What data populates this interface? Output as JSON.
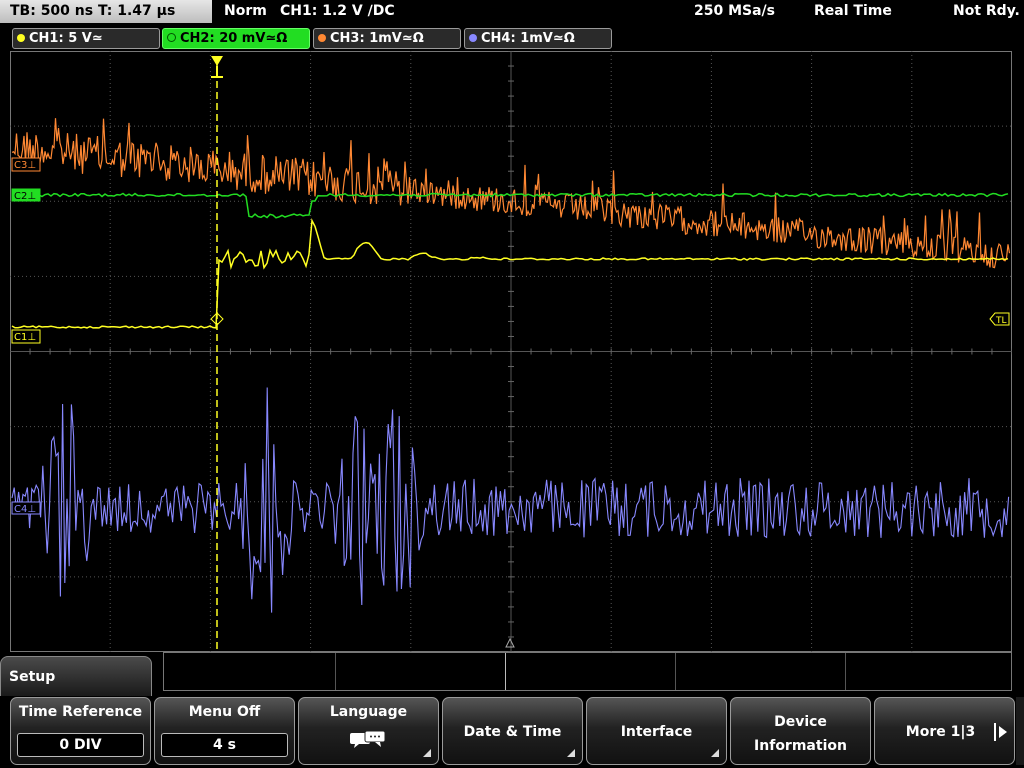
{
  "status": {
    "timebase": "TB: 500 ns   T: 1.47 µs",
    "trigger_mode": "Norm",
    "trigger": "CH1: 1.2 V ∕DC",
    "sample_rate": "250 MSa/s",
    "acq_mode": "Real Time",
    "state": "Not Rdy."
  },
  "channels": [
    {
      "label": "CH1: 5 V≃",
      "color": "#ffff22"
    },
    {
      "label": "CH2: 20 mV≃Ω",
      "color": "#22dd22"
    },
    {
      "label": "CH3: 1mV≃Ω",
      "color": "#ff8833"
    },
    {
      "label": "CH4: 1mV≃Ω",
      "color": "#8888ff"
    }
  ],
  "markers": {
    "c3": "C3⊥",
    "c2": "C2⊥",
    "c1": "C1⊥",
    "c4": "C4⊥",
    "trigger_level": "TL"
  },
  "menu": {
    "title": "Setup",
    "softkeys": {
      "time_reference": {
        "label": "Time Reference",
        "value": "0 DIV"
      },
      "menu_off": {
        "label": "Menu Off",
        "value": "4 s"
      },
      "language": {
        "label": "Language"
      },
      "date_time": {
        "label": "Date & Time"
      },
      "interface": {
        "label": "Interface"
      },
      "device_information": {
        "line1": "Device",
        "line2": "Information"
      },
      "more": {
        "label": "More 1|3"
      }
    }
  },
  "colors": {
    "ch1": "#ffff22",
    "ch2": "#22dd22",
    "ch3": "#ff8833",
    "ch4": "#8888ff",
    "grid": "#555555",
    "active_tab": "#22dd22"
  }
}
